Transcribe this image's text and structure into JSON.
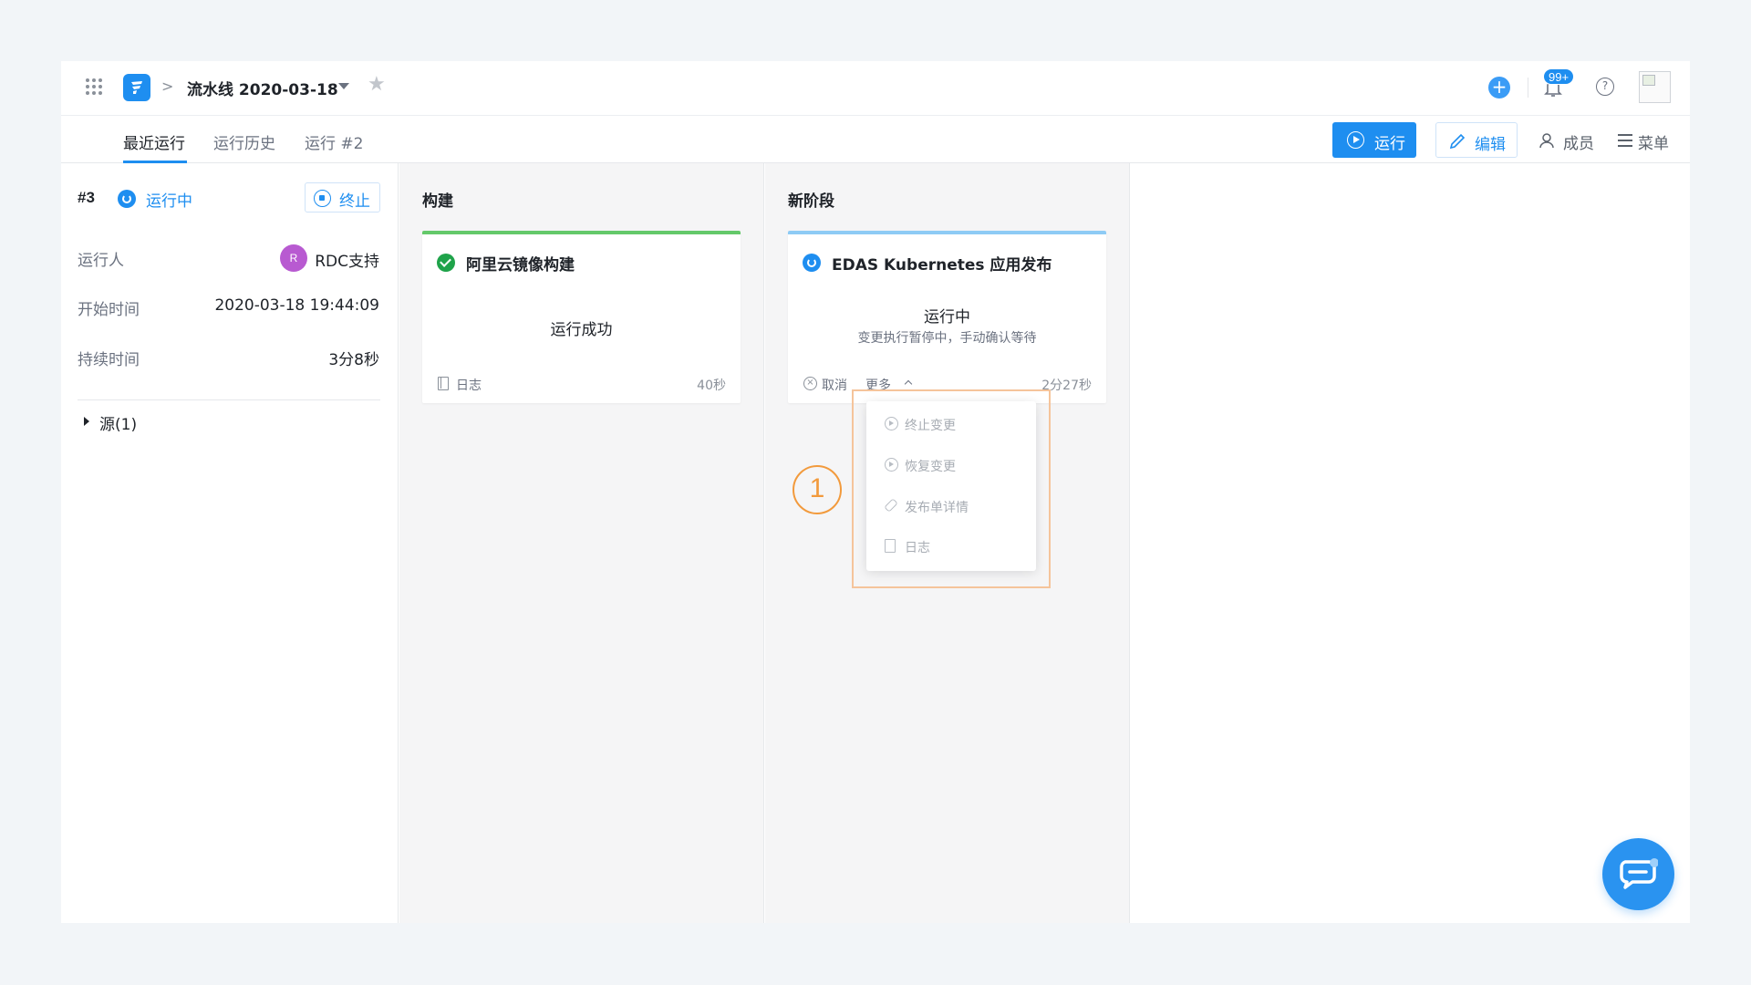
{
  "header": {
    "pipeline_title": "流水线 2020-03-18",
    "notification_badge": "99+",
    "help_glyph": "?",
    "breadcrumb_separator": ">"
  },
  "tabs": [
    {
      "label": "最近运行",
      "active": true
    },
    {
      "label": "运行历史",
      "active": false
    },
    {
      "label": "运行 #2",
      "active": false
    }
  ],
  "toolbar": {
    "run_label": "运行",
    "edit_label": "编辑",
    "members_label": "成员",
    "menu_label": "菜单"
  },
  "run_info": {
    "run_number": "#3",
    "status": "运行中",
    "stop_label": "终止",
    "runner_label": "运行人",
    "runner_initial": "R",
    "runner_name": "RDC支持",
    "start_label": "开始时间",
    "start_time": "2020-03-18 19:44:09",
    "duration_label": "持续时间",
    "duration": "3分8秒",
    "source_label": "源(1)"
  },
  "stages": [
    {
      "title": "构建",
      "job": {
        "name": "阿里云镜像构建",
        "status": "运行成功",
        "log_label": "日志",
        "duration": "40秒",
        "accent_color": "#64c96a"
      }
    },
    {
      "title": "新阶段",
      "job": {
        "name": "EDAS Kubernetes 应用发布",
        "status": "运行中",
        "sub_status": "变更执行暂停中，手动确认等待",
        "cancel_label": "取消",
        "more_label": "更多",
        "duration": "2分27秒",
        "accent_color": "#8ecbf5"
      }
    }
  ],
  "more_menu": [
    {
      "label": "终止变更",
      "icon": "play-circle-icon"
    },
    {
      "label": "恢复变更",
      "icon": "play-circle-icon"
    },
    {
      "label": "发布单详情",
      "icon": "link-icon"
    },
    {
      "label": "日志",
      "icon": "book-icon"
    }
  ],
  "annotation": "1",
  "colors": {
    "primary": "#1e8ef0",
    "success": "#1fa34a",
    "annotation": "#f29a3c"
  }
}
